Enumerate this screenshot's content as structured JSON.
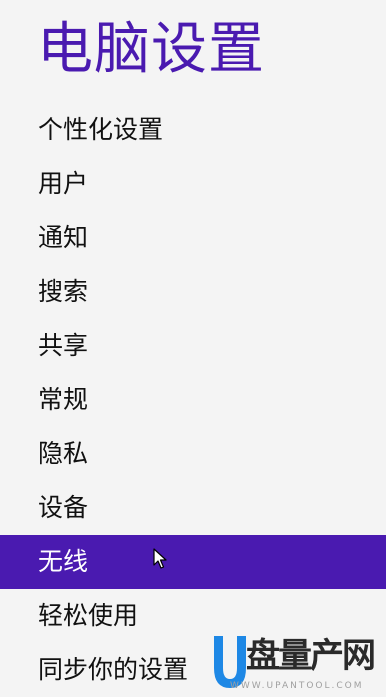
{
  "page": {
    "title": "电脑设置"
  },
  "nav": {
    "items": [
      {
        "label": "个性化设置",
        "name": "personalize"
      },
      {
        "label": "用户",
        "name": "users"
      },
      {
        "label": "通知",
        "name": "notifications"
      },
      {
        "label": "搜索",
        "name": "search"
      },
      {
        "label": "共享",
        "name": "share"
      },
      {
        "label": "常规",
        "name": "general"
      },
      {
        "label": "隐私",
        "name": "privacy"
      },
      {
        "label": "设备",
        "name": "devices"
      },
      {
        "label": "无线",
        "name": "wireless"
      },
      {
        "label": "轻松使用",
        "name": "ease-of-access"
      },
      {
        "label": "同步你的设置",
        "name": "sync-settings"
      }
    ],
    "selected": "无线"
  },
  "watermark": {
    "title": "盘量产网",
    "url": "WWW.UPANTOOL.COM"
  },
  "colors": {
    "accent": "#4a1ab0",
    "background": "#f4f4f4",
    "text": "#111111",
    "watermark_blue": "#1e88e5"
  }
}
